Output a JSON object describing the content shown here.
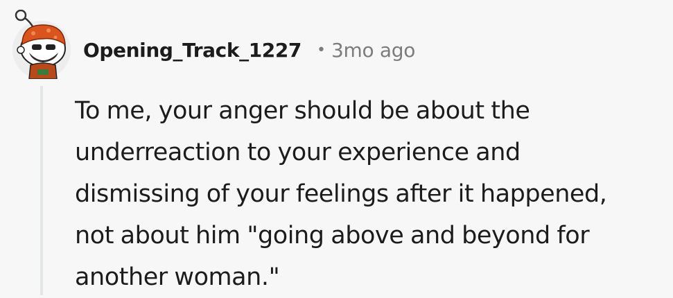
{
  "comment": {
    "author": "Opening_Track_1227",
    "separator": "•",
    "timestamp": "3mo ago",
    "body_lines": [
      "To me, your anger should be about the",
      "underreaction to your experience and",
      "dismissing of your feelings after it happened,",
      "not about him \"going above and beyond for",
      "another woman.\""
    ],
    "avatar_icon": "snoo-avatar-icon"
  },
  "colors": {
    "background": "#f7f7f8",
    "text": "#1c1c1c",
    "meta": "#7c7c7c",
    "thread_line": "#e3e5e8",
    "avatar_hat": "#d9541e"
  }
}
